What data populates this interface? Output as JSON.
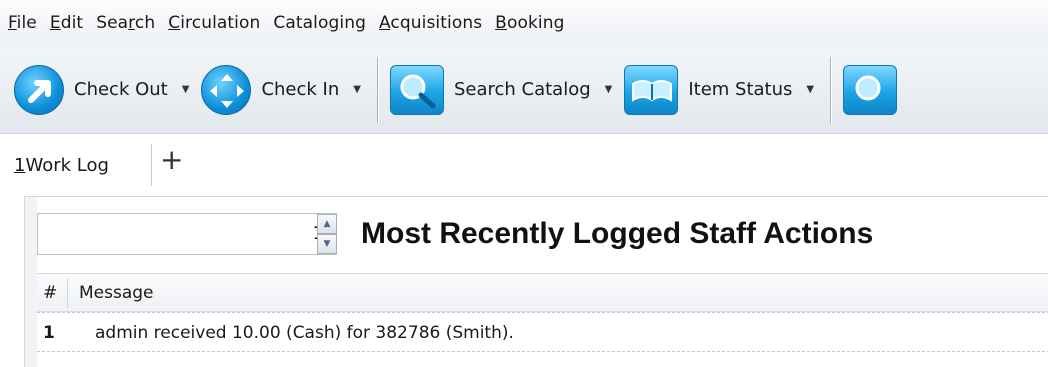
{
  "menubar": {
    "items": [
      {
        "accel": "F",
        "rest": "ile"
      },
      {
        "accel": "E",
        "rest": "dit"
      },
      {
        "pre": "Sea",
        "accel": "r",
        "rest": "ch"
      },
      {
        "accel": "C",
        "rest": "irculation"
      },
      {
        "pre": "Catalo",
        "accel": "g",
        "rest": "ing"
      },
      {
        "accel": "A",
        "rest": "cquisitions"
      },
      {
        "accel": "B",
        "rest": "ooking"
      }
    ]
  },
  "toolbar": {
    "checkout_label": "Check Out",
    "checkin_label": "Check In",
    "search_catalog_label": "Search Catalog",
    "item_status_label": "Item Status",
    "dropdown_glyph": "▼"
  },
  "tabs": {
    "worklog_accel": "1",
    "worklog_rest": " Work Log",
    "add_glyph": "+"
  },
  "panel": {
    "spinner_value": "1",
    "title": "Most Recently Logged Staff Actions",
    "columns": {
      "num": "#",
      "message": "Message"
    },
    "rows": [
      {
        "num": "1",
        "message": "admin received 10.00 (Cash) for 382786 (Smith)."
      }
    ]
  }
}
